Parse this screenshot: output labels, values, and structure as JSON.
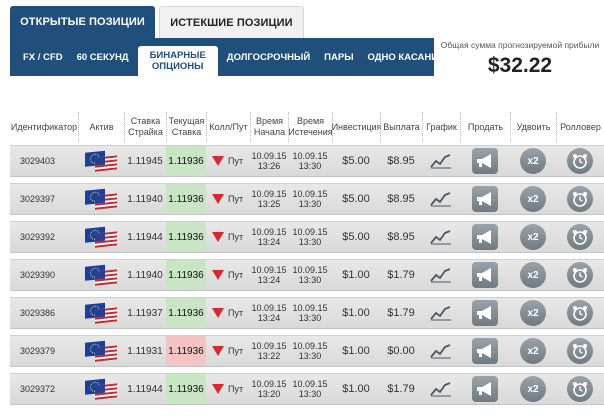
{
  "top_tabs": [
    {
      "label": "ОТКРЫТЫЕ ПОЗИЦИИ",
      "active": true
    },
    {
      "label": "ИСТЕКШИЕ ПОЗИЦИИ",
      "active": false
    }
  ],
  "sub_nav": [
    {
      "label": "FX / CFD"
    },
    {
      "label": "60 СЕКУНД"
    },
    {
      "label_line1": "БИНАРНЫЕ",
      "label_line2": "ОПЦИОНЫ",
      "active": true
    },
    {
      "label": "ДОЛГОСРОЧНЫЙ"
    },
    {
      "label": "ПАРЫ"
    },
    {
      "label": "ОДНО КАСАНИЕ"
    }
  ],
  "summary": {
    "label": "Общая сумма прогнозируемой прибыли",
    "value": "$32.22"
  },
  "columns": {
    "id": "Идентификатор",
    "asset": "Актив",
    "strike_1": "Ставка",
    "strike_2": "Страйка",
    "current_1": "Текущая",
    "current_2": "Ставка",
    "callput": "Колл/Пут",
    "start_1": "Время",
    "start_2": "Начала",
    "end_1": "Время",
    "end_2": "Истечения",
    "investment": "Инвестиция",
    "payout": "Выплата",
    "chart": "График",
    "sell": "Продать",
    "double": "Удвоить",
    "rollover": "Ролловер"
  },
  "rows": [
    {
      "id": "3029403",
      "strike": "1.11945",
      "current": "1.11936",
      "trend": "up",
      "type": "Пут",
      "start_date": "10.09.15",
      "start_time": "13:26",
      "end_date": "10.09.15",
      "end_time": "13:30",
      "investment": "$5.00",
      "payout": "$8.95",
      "double_label": "x2"
    },
    {
      "id": "3029397",
      "strike": "1.11940",
      "current": "1.11936",
      "trend": "up",
      "type": "Пут",
      "start_date": "10.09.15",
      "start_time": "13:25",
      "end_date": "10.09.15",
      "end_time": "13:30",
      "investment": "$5.00",
      "payout": "$8.95",
      "double_label": "x2"
    },
    {
      "id": "3029392",
      "strike": "1.11944",
      "current": "1.11936",
      "trend": "up",
      "type": "Пут",
      "start_date": "10.09.15",
      "start_time": "13:24",
      "end_date": "10.09.15",
      "end_time": "13:30",
      "investment": "$5.00",
      "payout": "$8.95",
      "double_label": "x2"
    },
    {
      "id": "3029390",
      "strike": "1.11940",
      "current": "1.11936",
      "trend": "up",
      "type": "Пут",
      "start_date": "10.09.15",
      "start_time": "13:24",
      "end_date": "10.09.15",
      "end_time": "13:30",
      "investment": "$1.00",
      "payout": "$1.79",
      "double_label": "x2"
    },
    {
      "id": "3029386",
      "strike": "1.11937",
      "current": "1.11936",
      "trend": "up",
      "type": "Пут",
      "start_date": "10.09.15",
      "start_time": "13:24",
      "end_date": "10.09.15",
      "end_time": "13:30",
      "investment": "$1.00",
      "payout": "$1.79",
      "double_label": "x2"
    },
    {
      "id": "3029379",
      "strike": "1.11931",
      "current": "1.11936",
      "trend": "down",
      "type": "Пут",
      "start_date": "10.09.15",
      "start_time": "13:22",
      "end_date": "10.09.15",
      "end_time": "13:30",
      "investment": "$1.00",
      "payout": "$0.00",
      "double_label": "x2"
    },
    {
      "id": "3029372",
      "strike": "1.11944",
      "current": "1.11936",
      "trend": "up",
      "type": "Пут",
      "start_date": "10.09.15",
      "start_time": "13:20",
      "end_date": "10.09.15",
      "end_time": "13:30",
      "investment": "$1.00",
      "payout": "$1.79",
      "double_label": "x2"
    }
  ],
  "colors": {
    "nav": "#1f4f7a",
    "up": "#c8e6c3",
    "down": "#f4c4c4",
    "put_arrow": "#d9282f"
  }
}
